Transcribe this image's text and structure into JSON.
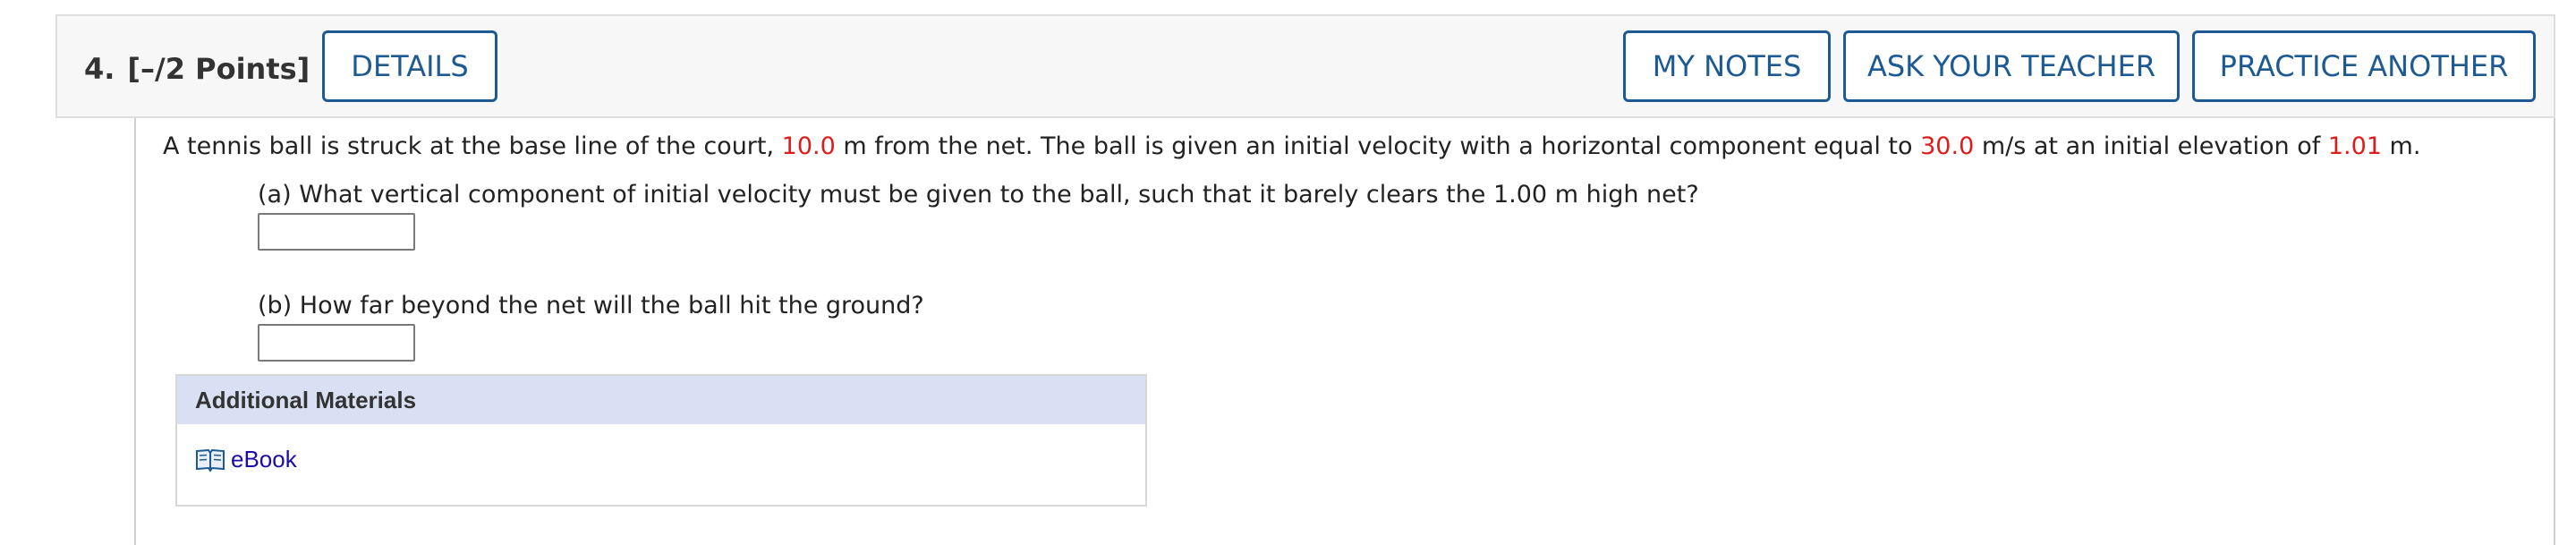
{
  "header": {
    "question_number": "4.",
    "points": "[–/2 Points]",
    "details_label": "DETAILS",
    "my_notes_label": "MY NOTES",
    "ask_teacher_label": "ASK YOUR TEACHER",
    "practice_label": "PRACTICE ANOTHER"
  },
  "problem": {
    "text1": "A tennis ball is struck at the base line of the court, ",
    "distance": "10.0",
    "text2": " m from the net. The ball is given an initial velocity with a horizontal component equal to ",
    "velocity": "30.0",
    "text3": " m/s at an initial elevation of ",
    "elevation": "1.01",
    "text4": " m."
  },
  "parts": {
    "a_question": "(a) What vertical component of initial velocity must be given to the ball, such that it barely clears the 1.00 m high net?",
    "a_answer": "",
    "b_question": "(b) How far beyond the net will the ball hit the ground?",
    "b_answer": ""
  },
  "materials": {
    "title": "Additional Materials",
    "ebook_label": "eBook",
    "ebook_icon": "book-icon"
  },
  "colors": {
    "accent": "#1d5a94",
    "given_value": "#e01b1b",
    "materials_header": "#d9e0f4",
    "link": "#1a0dab"
  }
}
